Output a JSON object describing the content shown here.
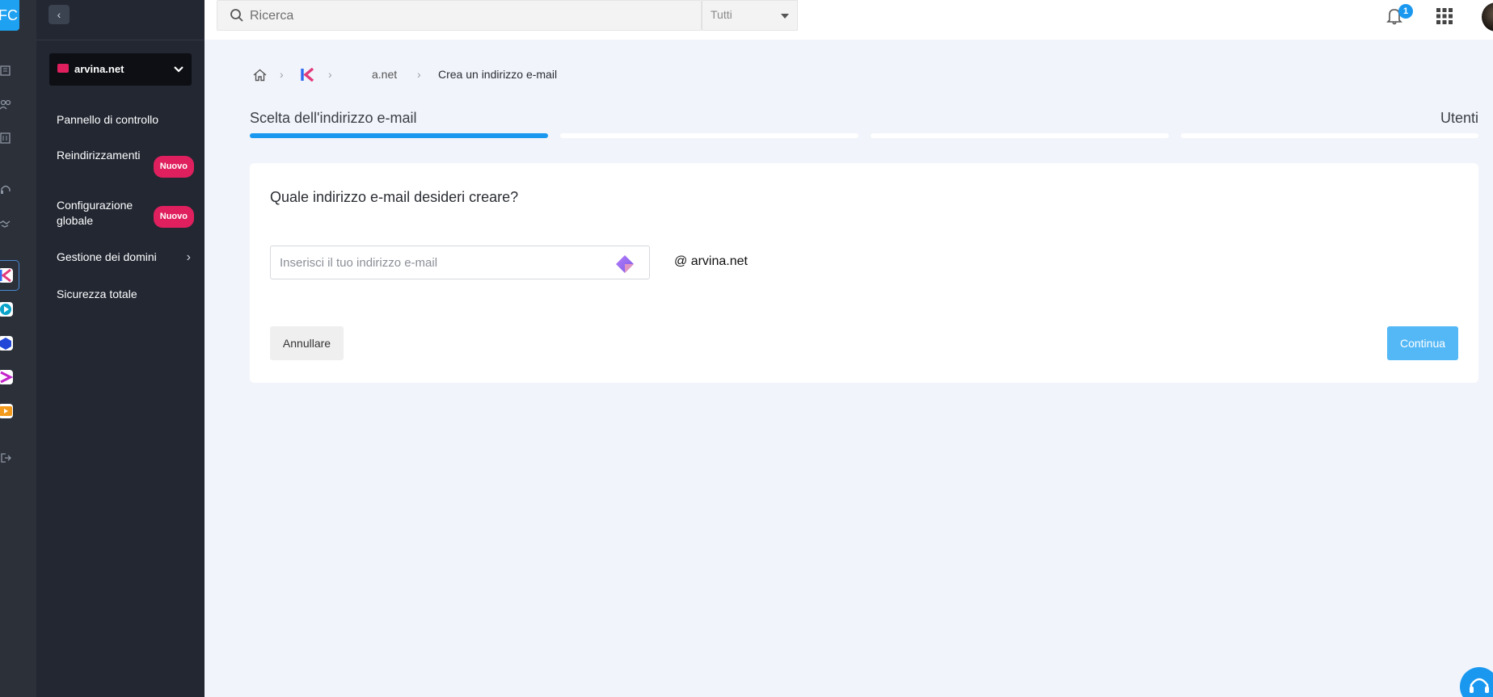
{
  "rail": {
    "logo_text": "FC",
    "apps": [
      "kappa-app-icon",
      "media-app-icon",
      "cube-app-icon",
      "split-app-icon",
      "play-app-icon"
    ]
  },
  "sidebar": {
    "domain": "arvina.net",
    "items": [
      {
        "label": "Pannello di controllo"
      },
      {
        "label": "Reindirizzamenti",
        "badge": "Nuovo"
      },
      {
        "label": "Configurazione globale",
        "badge": "Nuovo"
      },
      {
        "label": "Gestione dei domini"
      },
      {
        "label": "Sicurezza totale"
      }
    ]
  },
  "topbar": {
    "search_placeholder": "Ricerca",
    "scope": "Tutti",
    "notifications": "1"
  },
  "breadcrumb": {
    "domain": "a.net",
    "current": "Crea un indirizzo e-mail"
  },
  "stepper": {
    "first": "Scelta dell'indirizzo e-mail",
    "last": "Utenti"
  },
  "form": {
    "question": "Quale indirizzo e-mail desideri creare?",
    "email_placeholder": "Inserisci il tuo indirizzo e-mail",
    "domain_suffix": "@ arvina.net",
    "cancel": "Annullare",
    "continue": "Continua"
  },
  "colors": {
    "accent": "#1a98f0",
    "badge": "#e0205e",
    "sidebar_bg": "#222732"
  }
}
